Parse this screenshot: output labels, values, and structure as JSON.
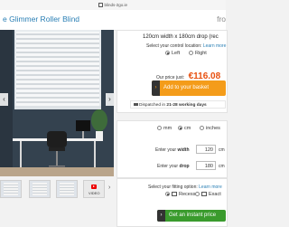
{
  "browser": {
    "url": "blinds-2go.ie"
  },
  "product": {
    "title": "e Glimmer Roller Blind",
    "title_cut": "fro"
  },
  "scene": {
    "prev_icon": "chevron-left-icon",
    "next_icon": "chevron-right-icon"
  },
  "thumbnails": {
    "video_label": "VIDEO",
    "next_icon": "chevron-right-icon"
  },
  "config": {
    "size_text": "120cm width x 180cm drop (rec",
    "control_label": "Select your control location:",
    "control_link": "Learn more",
    "control_options": [
      "Left",
      "Right"
    ],
    "control_selected": "Left",
    "price_label": "Our price just:",
    "price": "€116.08",
    "basket_label": "Add to your basket",
    "basket_arrow": "›",
    "dispatch_prefix": "Dispatched in",
    "dispatch_bold": "21-28 working days"
  },
  "units": {
    "options": [
      "mm",
      "cm",
      "inches"
    ],
    "selected": "cm"
  },
  "fields": {
    "width_prefix": "Enter your",
    "width_bold": "width",
    "width_value": "120",
    "drop_prefix": "Enter your",
    "drop_bold": "drop",
    "drop_value": "180",
    "unit": "cm"
  },
  "fitting": {
    "label": "Select your fitting option:",
    "link": "Learn more",
    "options": [
      "Recess",
      "Exact"
    ],
    "selected": "Recess",
    "instant_label": "Get an instant price",
    "instant_arrow": "›"
  },
  "colors": {
    "accent_orange": "#f49c1a",
    "price_orange": "#e84f0e",
    "green": "#3a9b2d",
    "link_blue": "#2a7fb5"
  }
}
